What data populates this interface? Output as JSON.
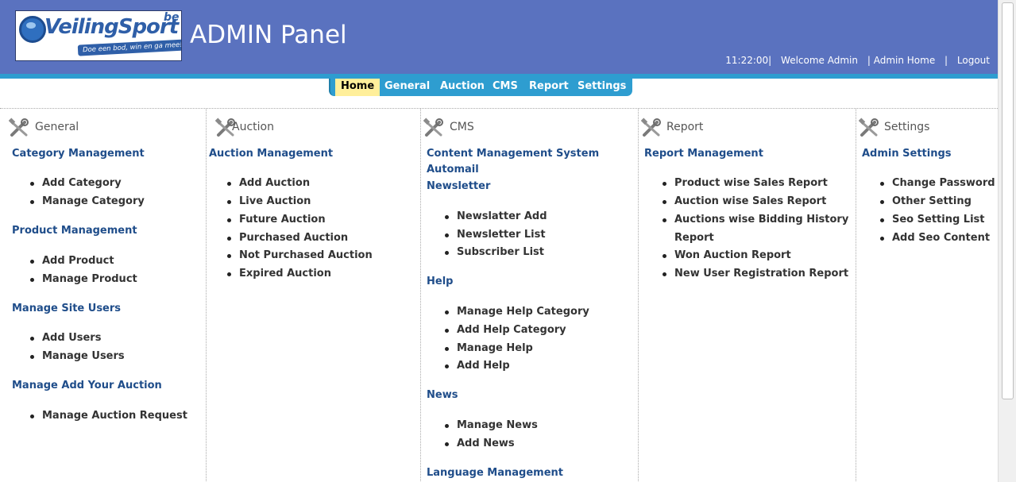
{
  "header": {
    "logo": {
      "brand": "VeilingSport",
      "suffix": "be",
      "slogan": "Doe een bod, win en ga mee!"
    },
    "title": "ADMIN Panel",
    "time": "11:22:00",
    "welcome": "Welcome Admin",
    "admin_home": "Admin Home",
    "logout": "Logout",
    "separator": "|",
    "colors": {
      "header_bg": "#5a72bf",
      "accent": "#2e9dd0",
      "active_tab": "#ffef9b",
      "link": "#1f4d8a"
    }
  },
  "nav": {
    "tabs": [
      {
        "label": "Home",
        "active": true
      },
      {
        "label": "General"
      },
      {
        "label": "Auction"
      },
      {
        "label": "CMS"
      },
      {
        "label": "Report"
      },
      {
        "label": "Settings"
      }
    ]
  },
  "columns": [
    {
      "title": "General",
      "icon": "tools-icon",
      "sections": [
        {
          "heading": "Category Management",
          "items": [
            "Add Category",
            "Manage Category"
          ]
        },
        {
          "heading": "Product Management",
          "items": [
            "Add Product",
            "Manage Product"
          ]
        },
        {
          "heading": "Manage Site Users",
          "items": [
            "Add Users",
            "Manage Users"
          ]
        },
        {
          "heading": "Manage Add Your Auction",
          "items": [
            "Manage Auction Request"
          ]
        }
      ]
    },
    {
      "title": "Auction",
      "icon": "tools-icon",
      "sections": [
        {
          "heading": "Auction Management",
          "items": [
            "Add Auction",
            "Live Auction",
            "Future Auction",
            "Purchased Auction",
            "Not Purchased Auction",
            "Expired Auction"
          ]
        }
      ]
    },
    {
      "title": "CMS",
      "icon": "tools-icon",
      "sections": [
        {
          "heading": "Content Management System",
          "items": []
        },
        {
          "heading": "Automail",
          "items": []
        },
        {
          "heading": "Newsletter",
          "items": [
            "Newslatter Add",
            "Newsletter List",
            "Subscriber List"
          ]
        },
        {
          "heading": "Help",
          "items": [
            "Manage Help Category",
            "Add Help Category",
            "Manage Help",
            "Add Help"
          ]
        },
        {
          "heading": "News",
          "items": [
            "Manage News",
            "Add News"
          ]
        },
        {
          "heading": "Language Management",
          "items": []
        }
      ]
    },
    {
      "title": "Report",
      "icon": "tools-icon",
      "sections": [
        {
          "heading": "Report Management",
          "items": [
            "Product wise Sales Report",
            "Auction wise Sales Report",
            "Auctions wise Bidding History",
            "Report",
            "Won Auction Report",
            "New User Registration Report"
          ]
        }
      ]
    },
    {
      "title": "Settings",
      "icon": "tools-icon",
      "sections": [
        {
          "heading": "Admin Settings",
          "items": [
            "Change Password",
            "Other Setting",
            "Seo Setting List",
            "Add Seo Content"
          ]
        }
      ]
    }
  ]
}
